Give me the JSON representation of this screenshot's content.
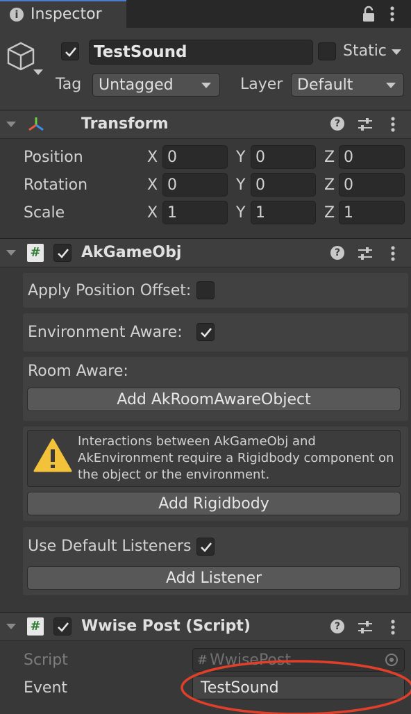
{
  "tab": {
    "title": "Inspector"
  },
  "object": {
    "enabled": true,
    "name": "TestSound",
    "static_label": "Static",
    "tag_label": "Tag",
    "tag_value": "Untagged",
    "layer_label": "Layer",
    "layer_value": "Default"
  },
  "transform": {
    "title": "Transform",
    "rows": [
      {
        "label": "Position",
        "x": "0",
        "y": "0",
        "z": "0"
      },
      {
        "label": "Rotation",
        "x": "0",
        "y": "0",
        "z": "0"
      },
      {
        "label": "Scale",
        "x": "1",
        "y": "1",
        "z": "1"
      }
    ],
    "axis": {
      "x": "X",
      "y": "Y",
      "z": "Z"
    }
  },
  "akgameobj": {
    "title": "AkGameObj",
    "apply_offset_label": "Apply Position Offset:",
    "env_aware_label": "Environment Aware:",
    "room_aware_label": "Room Aware:",
    "add_room_button": "Add AkRoomAwareObject",
    "warning_text": "Interactions between AkGameObj and AkEnvironment require a Rigidbody component on the object or the environment.",
    "add_rigidbody_button": "Add Rigidbody",
    "default_listeners_label": "Use Default Listeners",
    "add_listener_button": "Add Listener"
  },
  "wwisepost": {
    "title": "Wwise Post (Script)",
    "script_label": "Script",
    "script_value": "WwisePost",
    "event_label": "Event",
    "event_value": "TestSound"
  },
  "colors": {
    "accent": "#4c7ecf",
    "annotation": "#e0402a",
    "warning": "#f2c23a"
  }
}
